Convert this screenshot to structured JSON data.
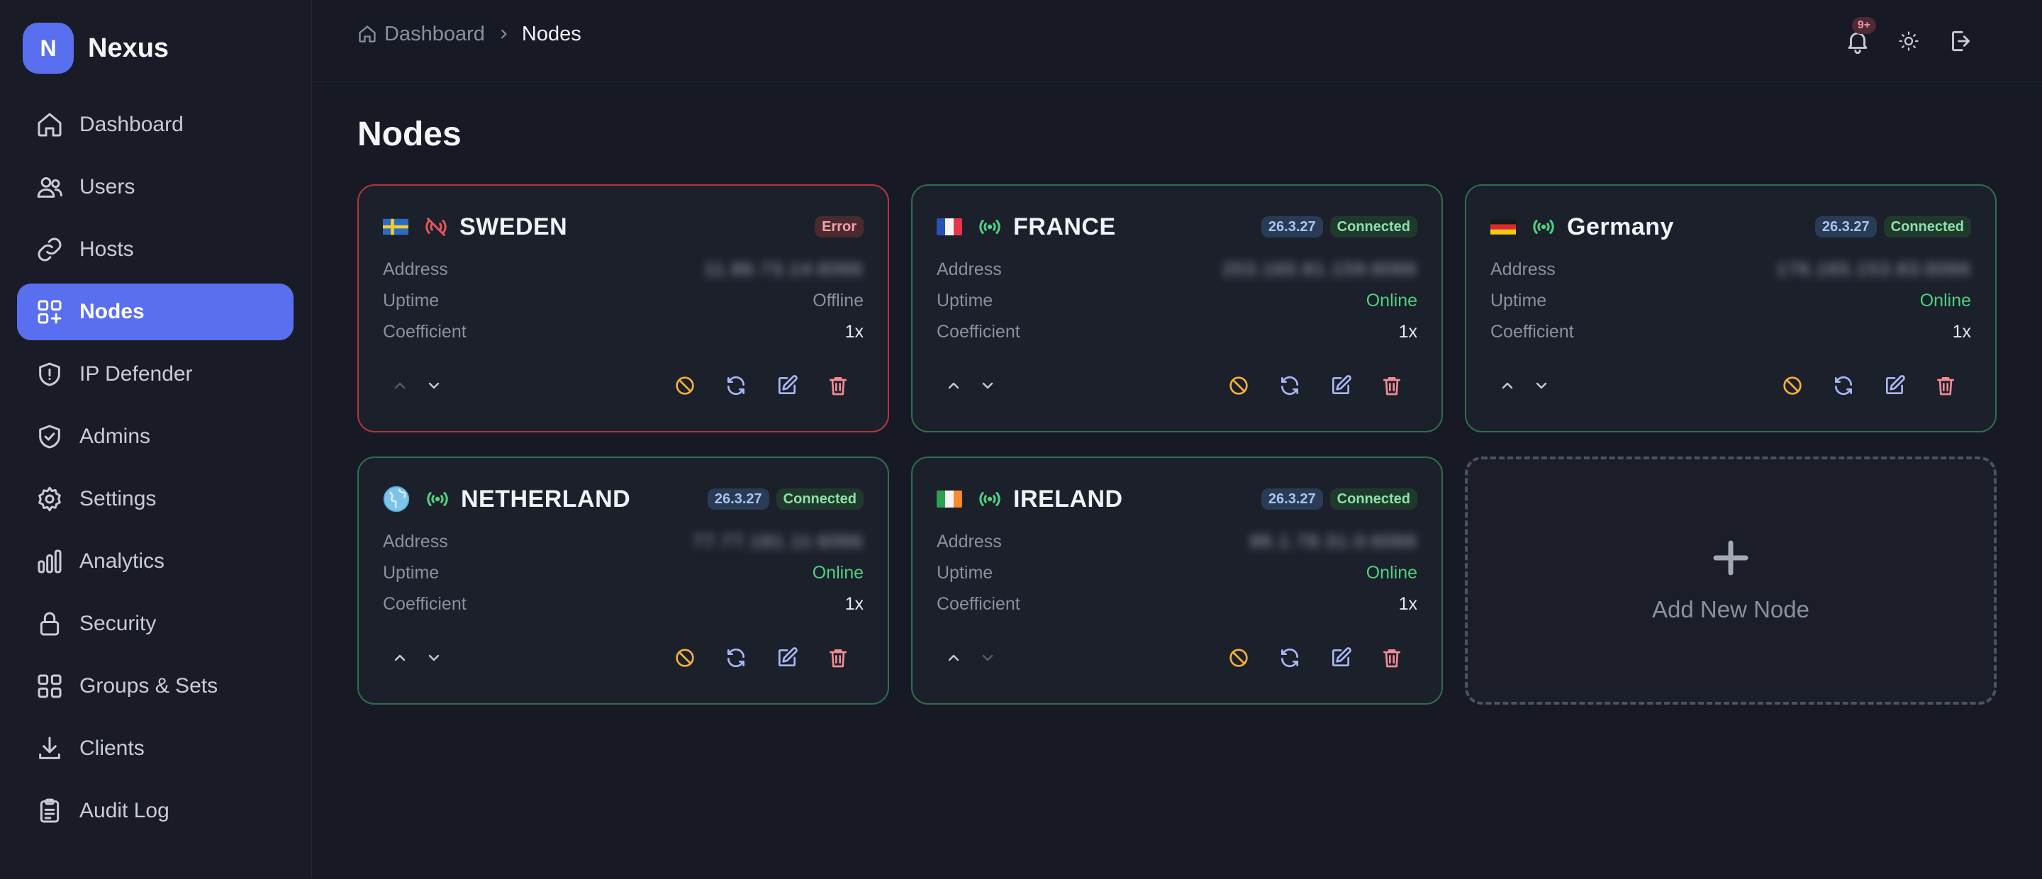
{
  "brand": {
    "initial": "N",
    "name": "Nexus"
  },
  "nav": [
    {
      "label": "Dashboard",
      "icon": "home-icon",
      "active": false
    },
    {
      "label": "Users",
      "icon": "users-icon",
      "active": false
    },
    {
      "label": "Hosts",
      "icon": "link-icon",
      "active": false
    },
    {
      "label": "Nodes",
      "icon": "grid-plus-icon",
      "active": true
    },
    {
      "label": "IP Defender",
      "icon": "shield-alert-icon",
      "active": false
    },
    {
      "label": "Admins",
      "icon": "shield-check-icon",
      "active": false
    },
    {
      "label": "Settings",
      "icon": "gear-icon",
      "active": false
    },
    {
      "label": "Analytics",
      "icon": "bar-chart-icon",
      "active": false
    },
    {
      "label": "Security",
      "icon": "lock-icon",
      "active": false
    },
    {
      "label": "Groups & Sets",
      "icon": "grid-icon",
      "active": false
    },
    {
      "label": "Clients",
      "icon": "download-icon",
      "active": false
    },
    {
      "label": "Audit Log",
      "icon": "clipboard-icon",
      "active": false
    }
  ],
  "breadcrumb": {
    "home": "Dashboard",
    "current": "Nodes"
  },
  "header": {
    "notification_badge": "9+"
  },
  "page_title": "Nodes",
  "labels": {
    "address": "Address",
    "uptime": "Uptime",
    "coefficient": "Coefficient"
  },
  "nodes": [
    {
      "name": "SWEDEN",
      "flag": "sweden-flag-icon",
      "status": "Error",
      "version": "",
      "address": "11.86.73.14:6066",
      "uptime": "Offline",
      "coefficient": "1x"
    },
    {
      "name": "FRANCE",
      "flag": "france-flag-icon",
      "status": "Connected",
      "version": "26.3.27",
      "address": "203.160.81.159:6066",
      "uptime": "Online",
      "coefficient": "1x"
    },
    {
      "name": "Germany",
      "flag": "germany-flag-icon",
      "status": "Connected",
      "version": "26.3.27",
      "address": "176.165.153.83:6066",
      "uptime": "Online",
      "coefficient": "1x"
    },
    {
      "name": "NETHERLAND",
      "flag": "globe-icon",
      "status": "Connected",
      "version": "26.3.27",
      "address": "77.77.181.11:6066",
      "uptime": "Online",
      "coefficient": "1x"
    },
    {
      "name": "IRELAND",
      "flag": "ireland-flag-icon",
      "status": "Connected",
      "version": "26.3.27",
      "address": "86.1.78.31.0:6066",
      "uptime": "Online",
      "coefficient": "1x"
    }
  ],
  "add_node": {
    "label": "Add New Node"
  },
  "colors": {
    "accent": "#5a6ff0",
    "online": "#4fd07f",
    "error_border": "#b2363e",
    "connected_border": "#2f6e4d",
    "disable": "#f5b13d",
    "refresh": "#a9b8f5",
    "delete": "#f28b95"
  }
}
